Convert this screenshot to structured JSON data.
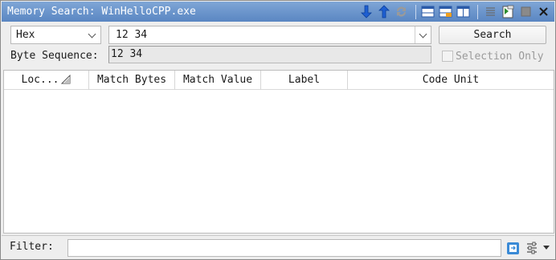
{
  "window": {
    "title": "Memory Search: WinHelloCPP.exe"
  },
  "toolbar": {
    "icons": [
      "next-match-icon",
      "previous-match-icon",
      "refresh-icon",
      "layout-horizontal-icon",
      "layout-split-icon",
      "layout-vertical-icon",
      "menu-icon",
      "snapshot-icon",
      "stop-icon",
      "close-icon"
    ]
  },
  "search": {
    "format_selected": "Hex",
    "input_value": "12 34",
    "button_label": "Search"
  },
  "byte_sequence": {
    "label": "Byte Sequence:",
    "value": "12 34"
  },
  "selection_only": {
    "label": "Selection Only",
    "checked": false
  },
  "table": {
    "columns": [
      "Loc...",
      "Match Bytes",
      "Match Value",
      "Label",
      "Code Unit"
    ],
    "rows": []
  },
  "filter": {
    "label": "Filter:",
    "value": ""
  }
}
